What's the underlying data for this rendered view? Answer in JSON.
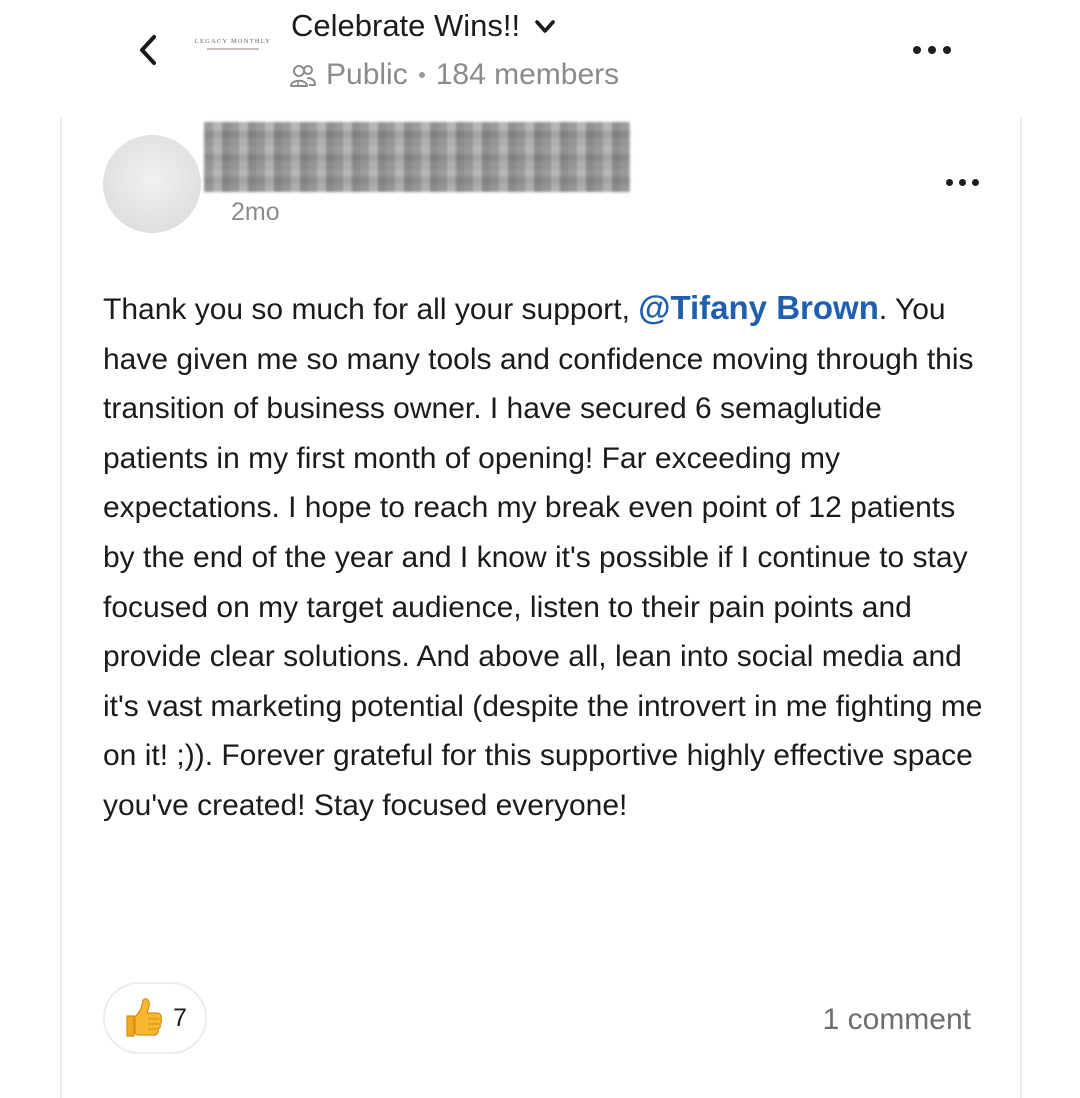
{
  "header": {
    "back_icon": "chevron-left-icon",
    "group_logo_text": "LEGACY MONTHLY",
    "group_title": "Celebrate Wins!!",
    "title_dropdown_icon": "chevron-down-icon",
    "members_icon": "people-icon",
    "visibility": "Public",
    "members_count": "184 members",
    "more_icon": "more-horizontal-icon"
  },
  "post": {
    "author_name": "",
    "time": "2mo",
    "more_icon": "more-horizontal-icon",
    "body_before_mention": "Thank you so much for all your support, ",
    "mention": "@Tifany Brown",
    "body_after_mention": ". You have given me so many tools and confidence moving through this transition of business owner. I have secured 6 semaglutide patients in my first month of opening! Far exceeding my expectations. I hope to reach my break even point of 12 patients by the end of the year and I know it's possible if I continue to stay focused on my target audience, listen to their pain points and provide clear solutions. And above all, lean into social media and it's vast marketing potential (despite the introvert in me fighting me on it! ;)).  Forever grateful for this supportive highly effective space you've created! Stay focused everyone!",
    "reaction_icon": "thumbs-up-icon",
    "reaction_count": "7",
    "comments_label": "1 comment"
  },
  "colors": {
    "mention": "#1f5fae",
    "muted_text": "#8b8b8b",
    "body_text": "#1b1b1b",
    "card_border": "#ececec",
    "thumb": "#f7b731"
  }
}
